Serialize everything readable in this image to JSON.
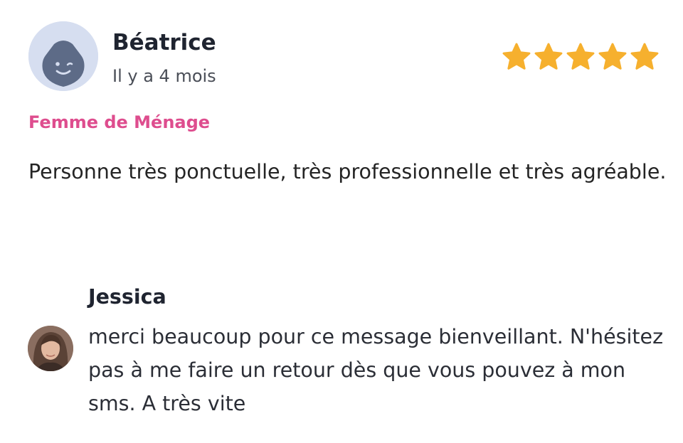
{
  "review": {
    "reviewer_name": "Béatrice",
    "date": "Il y a 4 mois",
    "rating": 5,
    "rating_max": 5,
    "star_color": "#f6b02e",
    "service": "Femme de Ménage",
    "service_color": "#de4d8e",
    "text": "Personne très ponctuelle, très professionnelle et très agréable.",
    "avatar_icon": "smiling-face-avatar-icon"
  },
  "reply": {
    "author_name": "Jessica",
    "text": "merci beaucoup pour ce message bienveillant. N'hésitez pas à me faire un retour dès que vous pouvez à mon sms. A très vite",
    "avatar_icon": "profile-photo-avatar"
  }
}
